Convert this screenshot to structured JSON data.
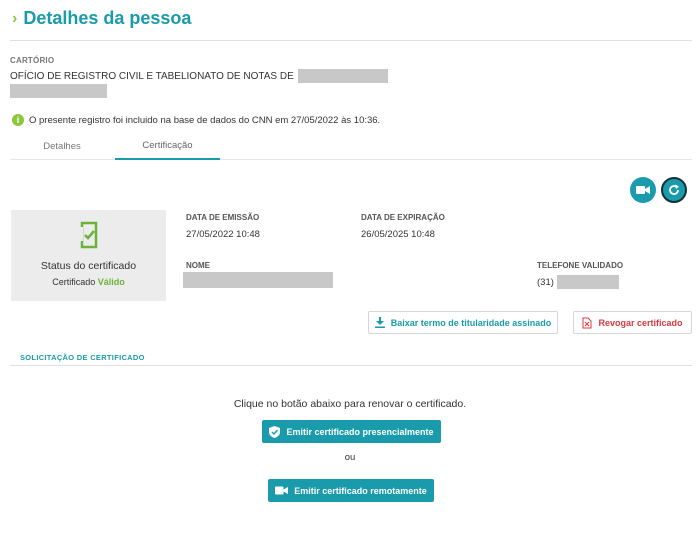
{
  "header": {
    "title": "Detalhes da pessoa"
  },
  "cartorio": {
    "label": "CARTÓRIO",
    "name": "OFÍCIO DE REGISTRO CIVIL E TABELIONATO DE NOTAS DE"
  },
  "info": {
    "text": "O presente registro foi incluido na base de dados do CNN em 27/05/2022 às 10:36."
  },
  "tabs": [
    {
      "label": "Detalhes",
      "active": false
    },
    {
      "label": "Certificação",
      "active": true
    }
  ],
  "actions": {
    "video_icon": "video-camera-icon",
    "refresh_icon": "refresh-icon"
  },
  "status_card": {
    "title": "Status do certificado",
    "subtitle_prefix": "Certificado",
    "status": "Válido",
    "status_color": "#6ab23a"
  },
  "fields": {
    "emissao_label": "DATA DE EMISSÃO",
    "emissao_value": "27/05/2022 10:48",
    "expiracao_label": "DATA DE EXPIRAÇÃO",
    "expiracao_value": "26/05/2025 10:48",
    "nome_label": "NOME",
    "telefone_label": "TELEFONE VALIDADO",
    "telefone_prefix": "(31)"
  },
  "buttons": {
    "baixar": "Baixar termo de titularidade assinado",
    "revogar": "Revogar certificado",
    "presencial": "Emitir certificado presencialmente",
    "remoto": "Emitir certificado remotamente"
  },
  "solicitacao": {
    "label": "SOLICITAÇÃO DE CERTIFICADO",
    "instruction": "Clique no botão abaixo para renovar o certificado.",
    "or": "ou"
  },
  "colors": {
    "accent": "#1a9bab",
    "green": "#8cc63f",
    "danger": "#d9393d"
  }
}
